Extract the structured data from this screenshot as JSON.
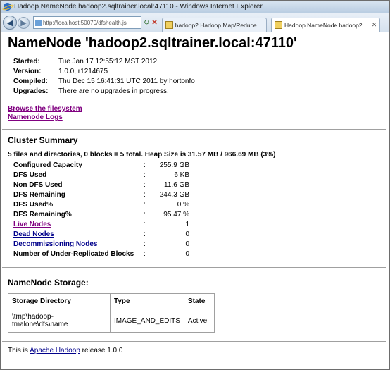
{
  "window": {
    "title": "Hadoop NameNode hadoop2.sqltrainer.local:47110 - Windows Internet Explorer",
    "address": "http://localhost:50070/dfshealth.js",
    "tabs": [
      {
        "label": "hadoop2 Hadoop Map/Reduce ..."
      },
      {
        "label": "Hadoop NameNode hadoop2..."
      }
    ]
  },
  "page": {
    "title": "NameNode 'hadoop2.sqltrainer.local:47110'",
    "info": [
      {
        "key": "Started:",
        "value": "Tue Jan 17 12:55:12 MST 2012"
      },
      {
        "key": "Version:",
        "value": "1.0.0, r1214675"
      },
      {
        "key": "Compiled:",
        "value": "Thu Dec 15 16:41:31 UTC 2011 by hortonfo"
      },
      {
        "key": "Upgrades:",
        "value": "There are no upgrades in progress."
      }
    ],
    "links": [
      "Browse the filesystem",
      "Namenode Logs"
    ],
    "cluster_summary": {
      "heading": "Cluster Summary",
      "summary_line": "5 files and directories, 0 blocks = 5 total. Heap Size is 31.57 MB / 966.69 MB (3%)",
      "rows": [
        {
          "key": "Configured Capacity",
          "colon": ":",
          "value": "255.9 GB"
        },
        {
          "key": "DFS Used",
          "colon": ":",
          "value": "6 KB"
        },
        {
          "key": "Non DFS Used",
          "colon": ":",
          "value": "11.6 GB"
        },
        {
          "key": "DFS Remaining",
          "colon": ":",
          "value": "244.3 GB"
        },
        {
          "key": "DFS Used%",
          "colon": ":",
          "value": "0 %"
        },
        {
          "key": "DFS Remaining%",
          "colon": ":",
          "value": "95.47 %"
        },
        {
          "key": "Live Nodes",
          "colon": ":",
          "value": "1"
        },
        {
          "key": "Dead Nodes",
          "colon": ":",
          "value": "0"
        },
        {
          "key": "Decommissioning Nodes",
          "colon": ":",
          "value": "0"
        },
        {
          "key": "Number of Under-Replicated Blocks",
          "colon": ":",
          "value": "0"
        }
      ]
    },
    "storage": {
      "heading": "NameNode Storage:",
      "headers": [
        "Storage Directory",
        "Type",
        "State"
      ],
      "row": [
        "\\tmp\\hadoop-tmalone\\dfs\\name",
        "IMAGE_AND_EDITS",
        "Active"
      ]
    },
    "footer": {
      "prefix": "This is ",
      "link": "Apache Hadoop",
      "suffix": " release 1.0.0"
    }
  }
}
